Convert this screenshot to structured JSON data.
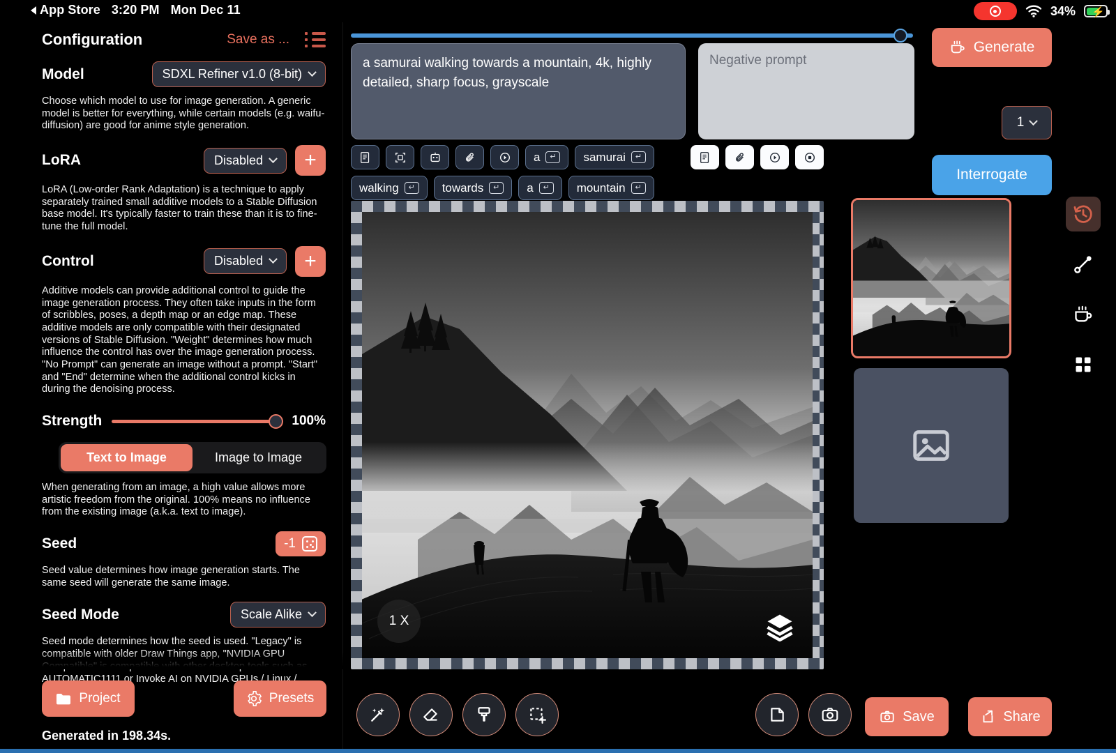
{
  "statusbar": {
    "back_label": "App Store",
    "time": "3:20 PM",
    "date": "Mon Dec 11",
    "battery_percent": "34%",
    "recording_icon": "record-pill-icon",
    "wifi_icon": "wifi-icon",
    "battery_icon": "battery-charging-icon"
  },
  "sidebar": {
    "title": "Configuration",
    "save_as": "Save as ...",
    "list_icon": "list-bullet-icon",
    "model": {
      "label": "Model",
      "value": "SDXL Refiner v1.0 (8-bit)",
      "desc": "Choose which model to use for image generation. A generic model is better for everything, while certain models (e.g. waifu-diffusion) are good for anime style generation."
    },
    "lora": {
      "label": "LoRA",
      "value": "Disabled",
      "add_label": "+",
      "desc": "LoRA (Low-order Rank Adaptation) is a technique to apply separately trained small additive models to a Stable Diffusion base model. It's typically faster to train these than it is to fine-tune the full model."
    },
    "control": {
      "label": "Control",
      "value": "Disabled",
      "add_label": "+",
      "desc": "Additive models can provide additional control to guide the image generation process. They often take inputs in the form of scribbles, poses, a depth map or an edge map. These additive models are only compatible with their designated versions of Stable Diffusion. \"Weight\" determines how much influence the control has over the image generation process. \"No Prompt\" can generate an image without a prompt. \"Start\" and \"End\" determine when the additional control kicks in during the denoising process."
    },
    "strength": {
      "label": "Strength",
      "value": "100%",
      "percent": 100
    },
    "mode_toggle": {
      "text_to_image": "Text to Image",
      "image_to_image": "Image to Image",
      "selected": "Text to Image",
      "desc": "When generating from an image, a high value allows more artistic freedom from the original. 100% means no influence from the existing image (a.k.a. text to image)."
    },
    "seed": {
      "label": "Seed",
      "value": "-1",
      "dice_icon": "dice-icon",
      "desc": "Seed value determines how image generation starts. The same seed will generate the same image."
    },
    "seed_mode": {
      "label": "Seed Mode",
      "value": "Scale Alike",
      "desc": "Seed mode determines how the seed is used. \"Legacy\" is compatible with older Draw Things app, \"NVIDIA GPU Compatible\" is compatible with other desktop tools such as AUTOMATIC1111 or Invoke AI on NVIDIA GPUs / Linux /"
    },
    "project_button": "Project",
    "presets_button": "Presets",
    "project_icon": "folder-icon",
    "presets_icon": "gear-icon",
    "generated_in": "Generated in 198.34s."
  },
  "center": {
    "top_slider_percent": 99,
    "prompt": {
      "value": "a samurai walking towards a mountain, 4k, highly detailed, sharp focus, grayscale"
    },
    "negative_prompt": {
      "placeholder": "Negative prompt",
      "value": ""
    },
    "prompt_chips": [
      {
        "type": "icon",
        "icon": "scroll-text-icon",
        "label": ""
      },
      {
        "type": "icon",
        "icon": "scan-frame-icon",
        "label": ""
      },
      {
        "type": "icon",
        "icon": "robot-icon",
        "label": ""
      },
      {
        "type": "icon",
        "icon": "paperclip-icon",
        "label": ""
      },
      {
        "type": "icon",
        "icon": "play-circle-icon",
        "label": ""
      },
      {
        "type": "word",
        "icon": "return-key-icon",
        "label": "a"
      },
      {
        "type": "word",
        "icon": "return-key-icon",
        "label": "samurai"
      },
      {
        "type": "word",
        "icon": "return-key-icon",
        "label": "walking"
      },
      {
        "type": "word",
        "icon": "return-key-icon",
        "label": "towards"
      },
      {
        "type": "word",
        "icon": "return-key-icon",
        "label": "a"
      },
      {
        "type": "word",
        "icon": "return-key-icon",
        "label": "mountain"
      },
      {
        "type": "word",
        "icon": "return-key-icon",
        "label": ","
      }
    ],
    "negative_chips": [
      {
        "icon": "scroll-text-icon"
      },
      {
        "icon": "paperclip-icon"
      },
      {
        "icon": "play-circle-icon"
      },
      {
        "icon": "record-circle-icon"
      }
    ],
    "canvas": {
      "zoom_level": "1 X",
      "layers_icon": "layers-icon",
      "image_description": "grayscale misty mountain landscape with two samurai silhouettes on a ridge and pine trees on the left"
    },
    "toolbar": [
      {
        "icon": "magic-wand-icon",
        "name": "magic-wand-tool"
      },
      {
        "icon": "eraser-icon",
        "name": "eraser-tool"
      },
      {
        "icon": "paintbrush-icon",
        "name": "paintbrush-tool"
      },
      {
        "icon": "selection-rect-icon",
        "name": "selection-tool"
      },
      {
        "icon": "note-icon",
        "name": "note-tool"
      },
      {
        "icon": "camera-icon",
        "name": "camera-tool"
      }
    ]
  },
  "right": {
    "generate_button": "Generate",
    "generate_icon": "coffee-cup-icon",
    "batch_count": "1",
    "interrogate_button": "Interrogate",
    "thumbnails": [
      {
        "name": "generated-thumbnail",
        "selected": true
      },
      {
        "name": "empty-thumbnail",
        "selected": false,
        "icon": "image-placeholder-icon"
      }
    ],
    "rail": [
      {
        "icon": "history-clock-icon",
        "name": "history-button",
        "active": true
      },
      {
        "icon": "link-line-icon",
        "name": "link-button",
        "active": false
      },
      {
        "icon": "coffee-cup-icon",
        "name": "coffee-button",
        "active": false
      },
      {
        "icon": "grid-icon",
        "name": "grid-button",
        "active": false
      }
    ],
    "save_button": "Save",
    "share_button": "Share",
    "save_icon": "camera-icon",
    "share_icon": "share-arrow-icon"
  },
  "colors": {
    "accent_salmon": "#ea7a67",
    "accent_blue": "#4aa3e8",
    "panel_slate": "#2b303c",
    "background": "#000000"
  }
}
